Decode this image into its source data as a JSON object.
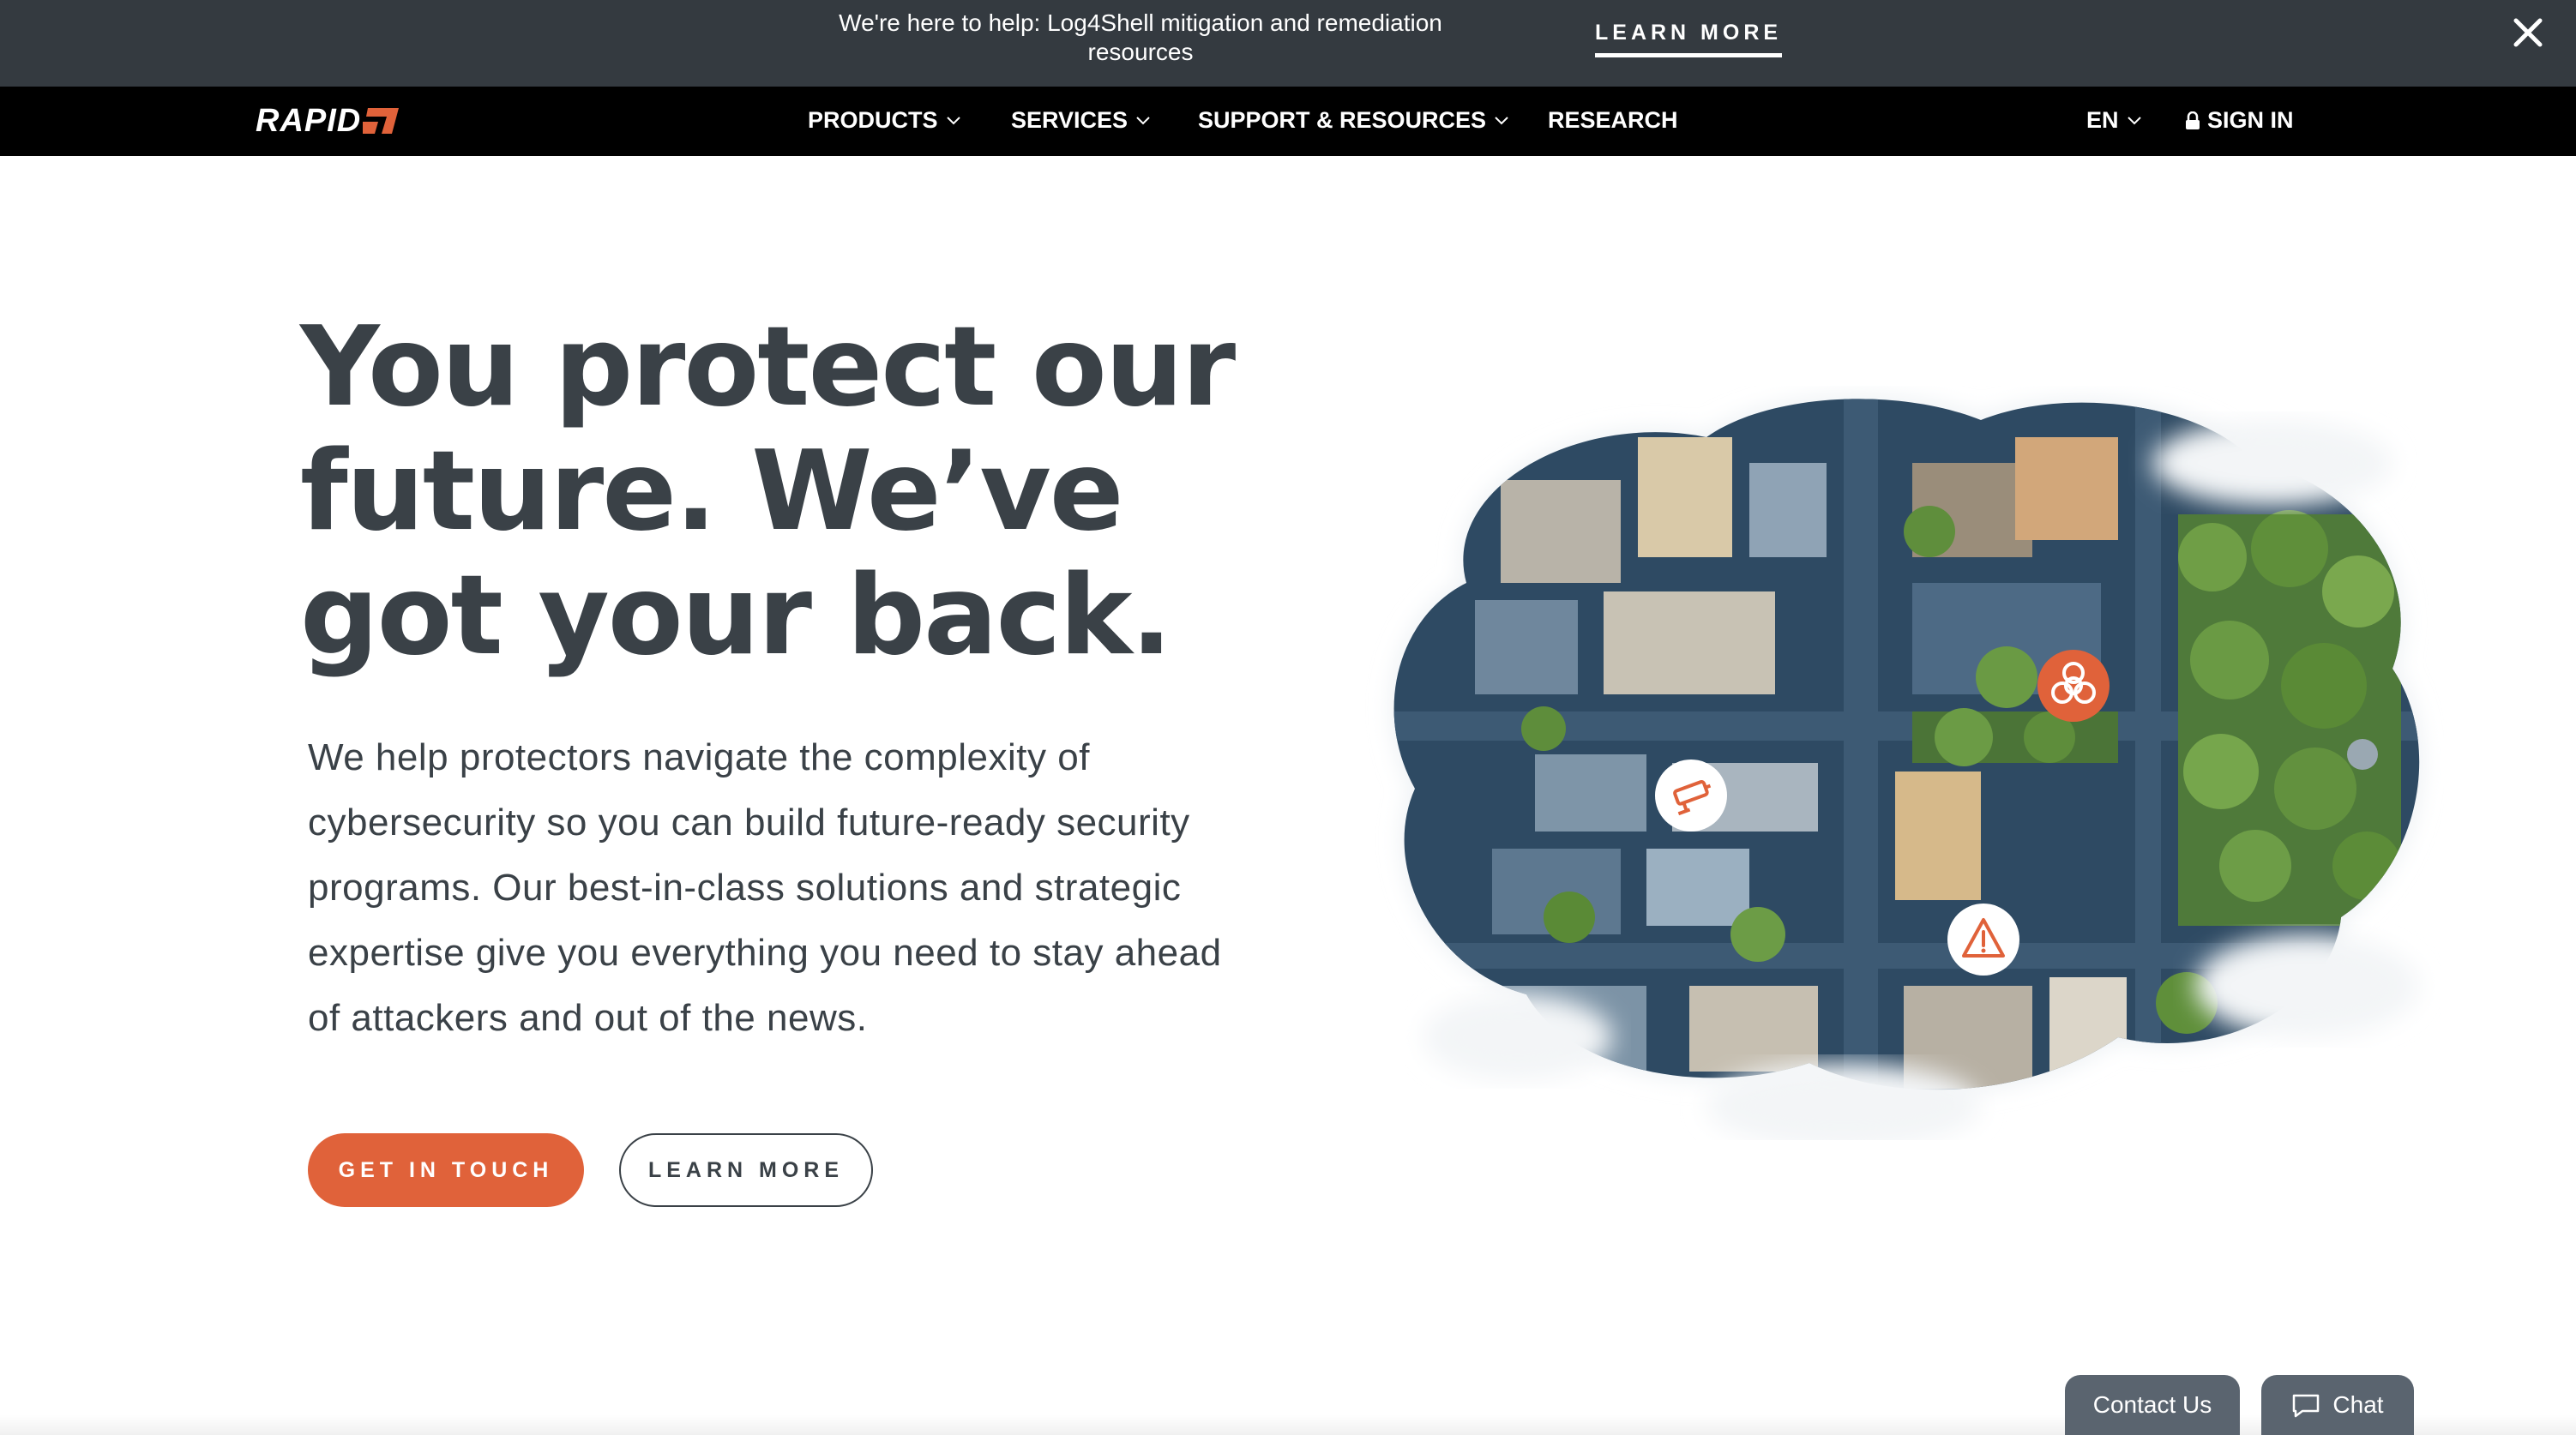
{
  "announcement": {
    "text": "We're here to help: Log4Shell mitigation and remediation resources",
    "link_label": "LEARN MORE",
    "close_icon": "close-icon"
  },
  "nav": {
    "logo_text": "RAPID",
    "logo_mark": "7",
    "items": [
      {
        "label": "PRODUCTS",
        "has_dropdown": true
      },
      {
        "label": "SERVICES",
        "has_dropdown": true
      },
      {
        "label": "SUPPORT & RESOURCES",
        "has_dropdown": true
      },
      {
        "label": "RESEARCH",
        "has_dropdown": false
      }
    ],
    "language": "EN",
    "signin": "SIGN IN"
  },
  "hero": {
    "headline_lines": [
      "You protect our",
      "future. We’ve",
      "got your back."
    ],
    "lead": "We help protectors navigate the complexity of cybersecurity so you can build future-ready security programs. Our best-in-class solutions and strategic expertise give you everything you need to stay ahead of attackers and out of the news.",
    "primary_cta": "GET IN TOUCH",
    "secondary_cta": "LEARN MORE",
    "pins": [
      "biohazard-icon",
      "security-camera-icon",
      "warning-icon"
    ]
  },
  "floating": {
    "contact": "Contact Us",
    "chat": "Chat"
  },
  "colors": {
    "accent": "#e0623a",
    "announcement_bg": "#343a40",
    "nav_bg": "#000000",
    "text": "#3a4147",
    "tab_bg": "#5a646f"
  }
}
